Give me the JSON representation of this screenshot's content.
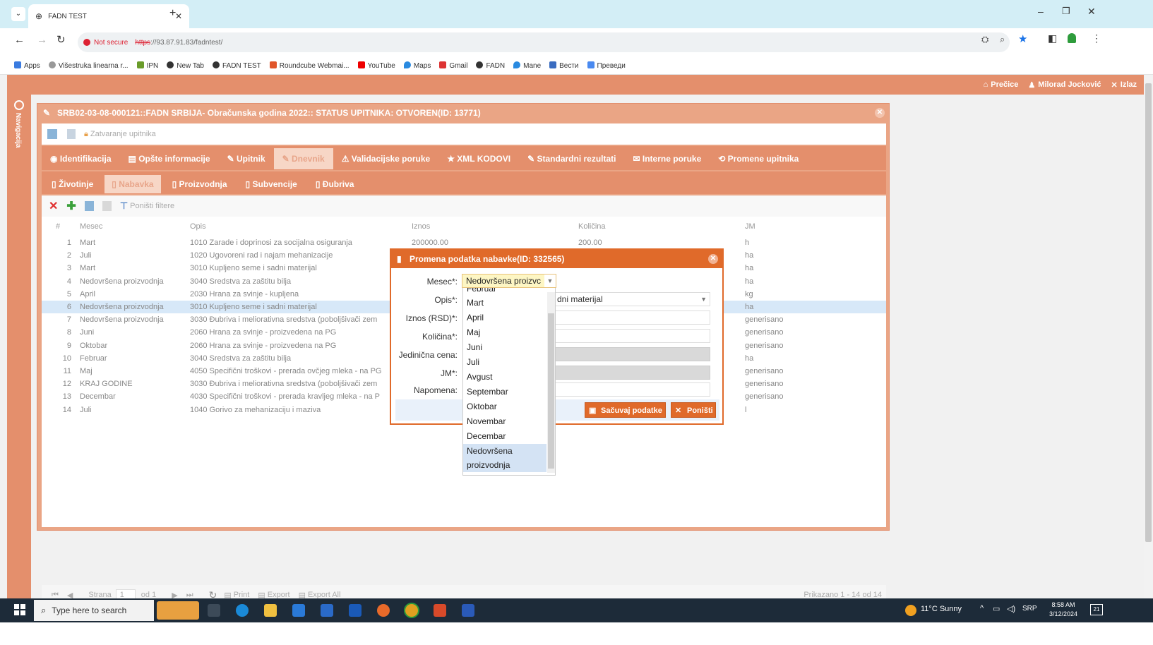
{
  "browser": {
    "tab_title": "FADN TEST",
    "not_secure": "Not secure",
    "url_scheme": "https",
    "url_rest": "://93.87.91.83/fadntest/",
    "bookmarks": [
      "Apps",
      "Višestruka linearna r...",
      "IPN",
      "New Tab",
      "FADN TEST",
      "Roundcube Webmai...",
      "YouTube",
      "Maps",
      "Gmail",
      "FADN",
      "Mane",
      "Вести",
      "Преведи"
    ]
  },
  "app": {
    "top_links": {
      "precice": "Prečice",
      "user": "Milorad Jocković",
      "logout": "Izlaz"
    },
    "left_nav_label": "Navigacija",
    "window_title": "SRB02-03-08-000121::FADN SRBIJA- Obračunska godina 2022:: STATUS UPITNIKA: OTVOREN(ID: 13771)",
    "toolbar": {
      "close_questionnaire": "Zatvaranje upitnika"
    },
    "tabs": [
      "Identifikacija",
      "Opšte informacije",
      "Upitnik",
      "Dnevnik",
      "Validacijske poruke",
      "XML KODOVI",
      "Standardni rezultati",
      "Interne poruke",
      "Promene upitnika"
    ],
    "active_tab": "Dnevnik",
    "subtabs": [
      "Životinje",
      "Nabavka",
      "Proizvodnja",
      "Subvencije",
      "Đubriva"
    ],
    "active_subtab": "Nabavka",
    "grid_toolbar": {
      "reset_filters": "Poništi filtere"
    },
    "grid": {
      "columns": [
        "#",
        "Mesec",
        "Opis",
        "Iznos",
        "Količina",
        "JM"
      ],
      "rows": [
        [
          "1",
          "Mart",
          "1010 Zarade i doprinosi za socijalna osiguranja",
          "200000.00",
          "200.00",
          "h"
        ],
        [
          "2",
          "Juli",
          "1020 Ugovoreni rad i najam mehanizacije",
          "",
          "",
          "ha"
        ],
        [
          "3",
          "Mart",
          "3010 Kupljeno seme i sadni materijal",
          "",
          "",
          "ha"
        ],
        [
          "4",
          "Nedovršena proizvodnja",
          "3040 Sredstva za zaštitu bilja",
          "",
          "",
          "ha"
        ],
        [
          "5",
          "April",
          "2030 Hrana za svinje - kupljena",
          "",
          "",
          "kg"
        ],
        [
          "6",
          "Nedovršena proizvodnja",
          "3010 Kupljeno seme i sadni materijal",
          "",
          "",
          "ha"
        ],
        [
          "7",
          "Nedovršena proizvodnja",
          "3030 Đubriva i meliorativna sredstva (poboljšivači zem",
          "",
          "",
          "generisano"
        ],
        [
          "8",
          "Juni",
          "2060 Hrana za svinje - proizvedena na PG",
          "",
          "",
          "generisano"
        ],
        [
          "9",
          "Oktobar",
          "2060 Hrana za svinje - proizvedena na PG",
          "",
          "",
          "generisano"
        ],
        [
          "10",
          "Februar",
          "3040 Sredstva za zaštitu bilja",
          "",
          "",
          "ha"
        ],
        [
          "11",
          "Maj",
          "4050 Specifični troškovi - prerada ovčjeg mleka - na PG",
          "",
          "",
          "generisano"
        ],
        [
          "12",
          "KRAJ GODINE",
          "3030 Đubriva i meliorativna sredstva (poboljšivači zem",
          "",
          "",
          "generisano"
        ],
        [
          "13",
          "Decembar",
          "4030 Specifični troškovi - prerada kravljeg mleka - na P",
          "",
          "",
          "generisano"
        ],
        [
          "14",
          "Juli",
          "1040 Gorivo za mehanizaciju i maziva",
          "",
          "",
          "l"
        ]
      ],
      "selected_row": 6
    },
    "pager": {
      "page_label": "Strana",
      "page": "1",
      "of": "od 1",
      "print": "Print",
      "export": "Export",
      "export_all": "Export All",
      "summary": "Prikazano 1 - 14 od 14"
    }
  },
  "dialog": {
    "title": "Promena podatka nabavke(ID: 332565)",
    "labels": {
      "mesec": "Mesec*:",
      "opis": "Opis*:",
      "iznos": "Iznos (RSD)*:",
      "kolicina": "Količina*:",
      "jedinicna": "Jedinična cena:",
      "jm": "JM*:",
      "napomena": "Napomena:"
    },
    "mesec_value": "Nedovršena proizvc",
    "opis_value_visible": "dni materijal",
    "save_button": "Sačuvaj podatke",
    "cancel_button": "Poništi",
    "dropdown_options": [
      "Februar",
      "Mart",
      "April",
      "Maj",
      "Juni",
      "Juli",
      "Avgust",
      "Septembar",
      "Oktobar",
      "Novembar",
      "Decembar",
      "Nedovršena proizvodnja"
    ],
    "dropdown_highlighted": "Nedovršena proizvodnja"
  },
  "taskbar": {
    "search_placeholder": "Type here to search",
    "weather": "11°C  Sunny",
    "lang": "SRP",
    "time": "8:58 AM",
    "date": "3/12/2024",
    "notif_count": "21"
  },
  "colors": {
    "accent": "#e48f6c",
    "dialog_accent": "#e06a2a",
    "taskbar": "#1d2b39",
    "tabstrip": "#d3eef6"
  }
}
